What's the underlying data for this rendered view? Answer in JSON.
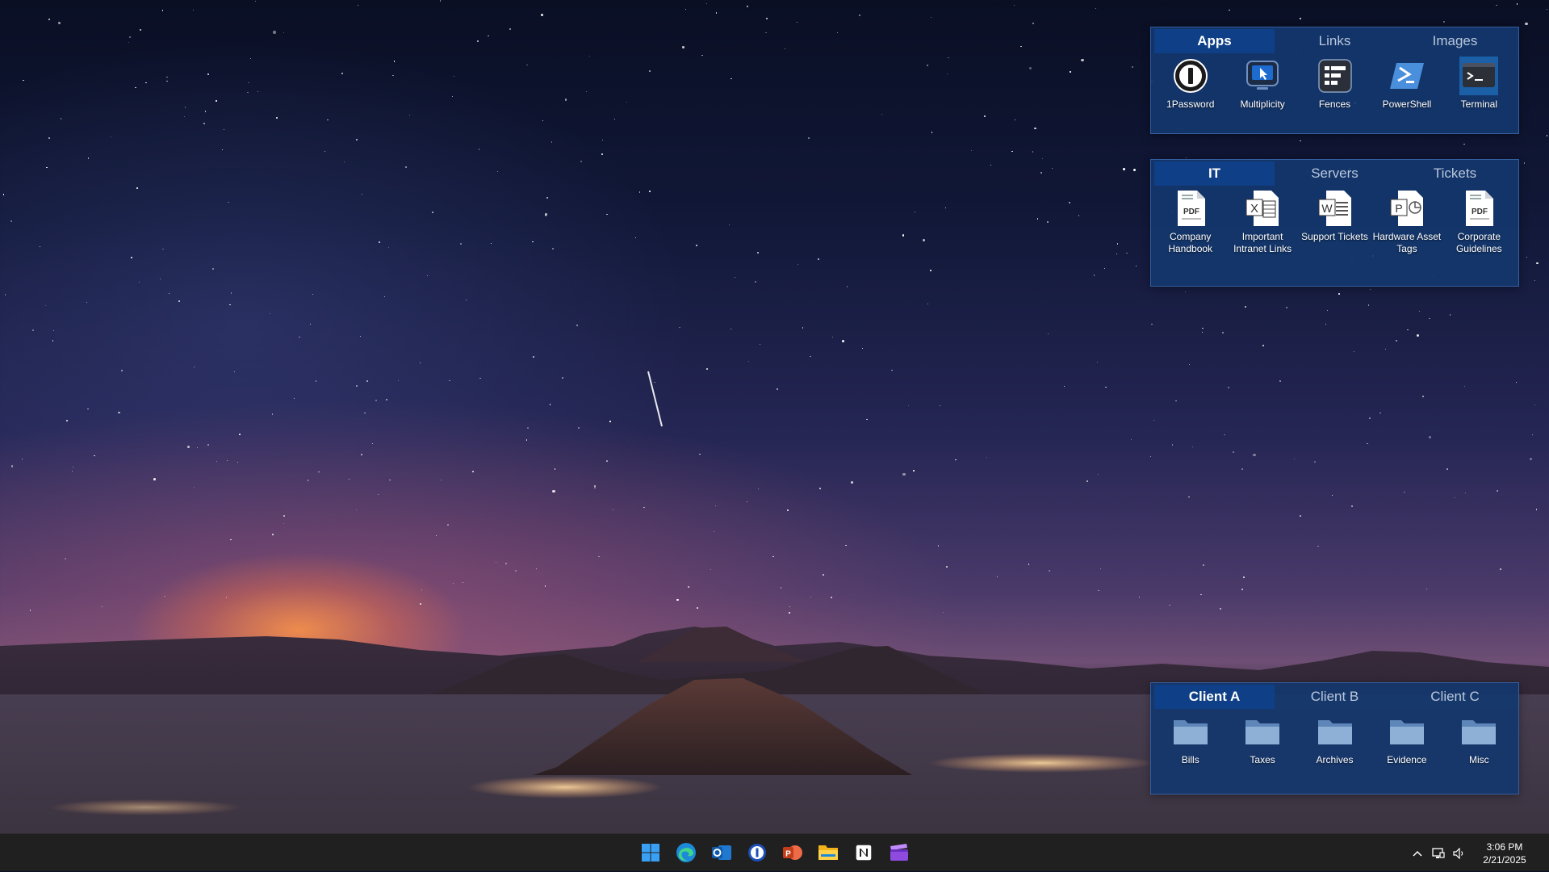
{
  "fences": [
    {
      "tabs": [
        {
          "label": "Apps",
          "active": true
        },
        {
          "label": "Links",
          "active": false
        },
        {
          "label": "Images",
          "active": false
        }
      ],
      "items": [
        {
          "label": "1Password",
          "icon": "onepassword-icon"
        },
        {
          "label": "Multiplicity",
          "icon": "multiplicity-icon"
        },
        {
          "label": "Fences",
          "icon": "fences-icon"
        },
        {
          "label": "PowerShell",
          "icon": "powershell-icon"
        },
        {
          "label": "Terminal",
          "icon": "terminal-icon"
        }
      ]
    },
    {
      "tabs": [
        {
          "label": "IT",
          "active": true
        },
        {
          "label": "Servers",
          "active": false
        },
        {
          "label": "Tickets",
          "active": false
        }
      ],
      "items": [
        {
          "label": "Company Handbook",
          "icon": "pdf-icon",
          "badge": "PDF"
        },
        {
          "label": "Important Intranet Links",
          "icon": "excel-icon",
          "badge": "X"
        },
        {
          "label": "Support Tickets",
          "icon": "word-icon",
          "badge": "W"
        },
        {
          "label": "Hardware Asset Tags",
          "icon": "powerpoint-icon",
          "badge": "P"
        },
        {
          "label": "Corporate Guidelines",
          "icon": "pdf-icon",
          "badge": "PDF"
        }
      ]
    },
    {
      "tabs": [
        {
          "label": "Client A",
          "active": true
        },
        {
          "label": "Client B",
          "active": false
        },
        {
          "label": "Client C",
          "active": false
        }
      ],
      "items": [
        {
          "label": "Bills",
          "icon": "folder-icon"
        },
        {
          "label": "Taxes",
          "icon": "folder-icon"
        },
        {
          "label": "Archives",
          "icon": "folder-icon"
        },
        {
          "label": "Evidence",
          "icon": "folder-icon"
        },
        {
          "label": "Misc",
          "icon": "folder-icon"
        }
      ]
    }
  ],
  "taskbar": {
    "apps": [
      "windows-start-icon",
      "edge-icon",
      "outlook-icon",
      "onepassword-icon",
      "powerpoint-icon",
      "file-explorer-icon",
      "notion-icon",
      "clapper-app-icon"
    ],
    "tray": [
      "chevron-up-icon",
      "network-icon",
      "volume-icon"
    ],
    "time": "3:06 PM",
    "date": "2/21/2025"
  },
  "colors": {
    "fence_bg": "#14376e",
    "tab_active": "#0f3f86",
    "taskbar": "#202020",
    "accent": "#0078d4"
  }
}
